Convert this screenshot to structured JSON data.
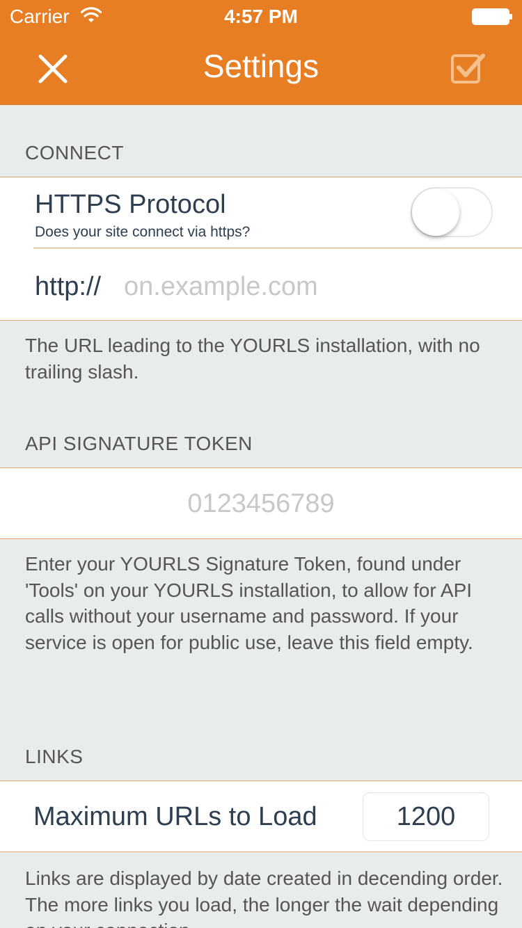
{
  "status_bar": {
    "carrier": "Carrier",
    "time": "4:57 PM"
  },
  "navbar": {
    "title": "Settings",
    "close_icon": "close-icon",
    "done_icon": "checkbox-check-icon"
  },
  "colors": {
    "accent": "#e77e23",
    "background": "#e8ecec",
    "separator": "#e8a56b"
  },
  "connect": {
    "header": "CONNECT",
    "https_title": "HTTPS Protocol",
    "https_subtitle": "Does your site connect via https?",
    "https_enabled": false,
    "url_prefix": "http://",
    "url_value": "",
    "url_placeholder": "on.example.com",
    "footer": "The URL leading to the YOURLS installation, with no trailing slash."
  },
  "api": {
    "header": "API SIGNATURE TOKEN",
    "token_value": "",
    "token_placeholder": "0123456789",
    "footer": "Enter your YOURLS Signature Token, found under 'Tools' on your YOURLS installation, to allow for API calls without your username and password. If your service is open for public use, leave this field empty."
  },
  "links": {
    "header": "LINKS",
    "max_label": "Maximum URLs to Load",
    "max_value": "1200",
    "footer": "Links are displayed by date created in decending order. The more links you load, the longer the wait depending on your connection."
  }
}
